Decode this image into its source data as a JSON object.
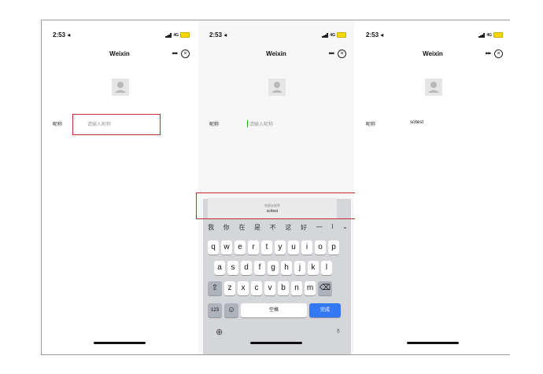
{
  "screens": [
    {
      "status": {
        "time": "2:53 ◂",
        "network": "4G"
      },
      "title": "Weixin",
      "field_label": "昵称",
      "field_placeholder": "请输入昵称"
    },
    {
      "status": {
        "time": "2:53 ◂",
        "network": "4G"
      },
      "title": "Weixin",
      "field_label": "昵称",
      "field_placeholder": "请输入昵称",
      "prediction_hint": "和朋友昵称",
      "prediction_word": "scitest",
      "candidates": [
        "我",
        "你",
        "在",
        "是",
        "不",
        "这",
        "好",
        "一",
        "I"
      ],
      "keyboard": {
        "row1": [
          "q",
          "w",
          "e",
          "r",
          "t",
          "y",
          "u",
          "i",
          "o",
          "p"
        ],
        "row2": [
          "a",
          "s",
          "d",
          "f",
          "g",
          "h",
          "j",
          "k",
          "l"
        ],
        "row3": [
          "z",
          "x",
          "c",
          "v",
          "b",
          "n",
          "m"
        ],
        "num_key": "123",
        "space_key": "空格",
        "done_key": "完成"
      }
    },
    {
      "status": {
        "time": "2:53 ◂",
        "network": "4G"
      },
      "title": "Weixin",
      "field_label": "昵称",
      "field_value": "scitest"
    }
  ]
}
